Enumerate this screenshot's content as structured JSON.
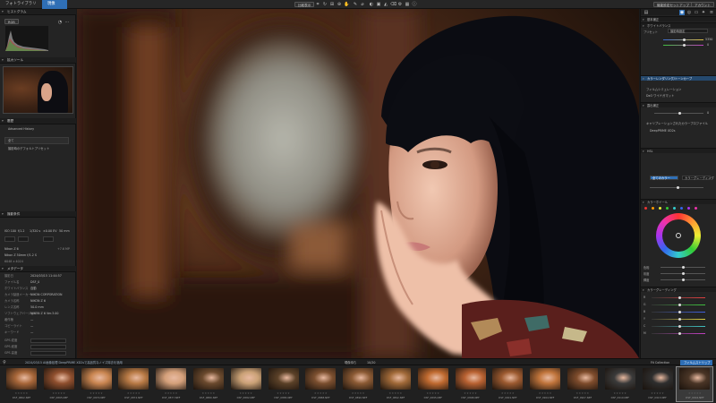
{
  "topbar": {
    "tabs": [
      {
        "label": "フォトライブラリ",
        "active": false
      },
      {
        "label": "現像",
        "active": true
      }
    ],
    "compare_label": "比較表示",
    "export_label": "書き出し",
    "workspace_label": "ワークスペース",
    "right_buttons": [
      "機能設定セットアップ",
      "アカウント"
    ]
  },
  "left": {
    "histogram_title": "ヒストグラム",
    "histogram_mode": "RGB",
    "navigator_title": "拡大ツール",
    "history_title": "履歴",
    "history_subtitle": "Advanced History",
    "history_items": [
      "全て",
      "撮影時のデフォルトプリセット"
    ],
    "exif_title": "撮影条件",
    "exif_top": [
      "ISO 100",
      "f/1.2",
      "1/320 s",
      "±0.00 EV",
      "50 mm"
    ],
    "lens_mount": "Nikon Z 6",
    "lens_name": "Nikon Z 50mm f/1.2 S",
    "image_size": "6048 x 4024",
    "camera_id": "+7.6 MP",
    "meta_title": "メタデータ",
    "meta_rows": [
      {
        "label": "撮影日",
        "value": "2024/03/15 11:44:57"
      },
      {
        "label": "ファイル名",
        "value": "DSF_0"
      },
      {
        "label": "ホワイトバランス",
        "value": "自動"
      },
      {
        "label": "カメラ製造メーカー",
        "value": "NIKON CORPORATION"
      },
      {
        "label": "カメラ名称",
        "value": "NIKON Z 6"
      },
      {
        "label": "レンズ名称",
        "value": "50.0 mm"
      },
      {
        "label": "ソフトウェアバージョン",
        "value": "NIKON Z 6 Ver.3.00"
      },
      {
        "label": "著作権",
        "value": "—"
      },
      {
        "label": "コピーライト",
        "value": "—"
      },
      {
        "label": "キーワード",
        "value": "—"
      }
    ],
    "gps_rows": [
      "GPS 緯度",
      "GPS 経度",
      "GPS 高度"
    ]
  },
  "right": {
    "header": "基本補正",
    "sections": [
      "ホワイトバランス",
      "カラーレンダリング/トーンカーブ",
      "露出補正",
      "HSL",
      "カラーホイール",
      "カラーグレーディング"
    ],
    "wb_preset": "撮影時設定",
    "temp_value": "5350",
    "tint_value": "0",
    "tone_type": "フィルムシミュレーション",
    "profile_name": "DxO ワイドガマット",
    "exposure_value": "0",
    "vignette_label": "キャリブレーションされたカラープロファイル",
    "deep_prime_label": "DeepPRIME XD2s",
    "hsl_mode": "全てのカラー",
    "grading_mode": "カラーグレーディング",
    "wheel_rows": [
      "色相",
      "彩度",
      "輝度"
    ],
    "channel_rows": [
      "R",
      "G",
      "B",
      "Y",
      "C",
      "M"
    ]
  },
  "statusbar": {
    "left_text": "2024/03/15 AI画像処理 DeepPRIME XD2sで高品質なノイズ除去を適用",
    "center_text": "現像待ち",
    "count": "10/20",
    "right_label": "フィルムストリップ",
    "fit_label": "Fit Collection"
  },
  "filmstrip": {
    "thumbs": [
      {
        "name": "DSF_0862.NEF",
        "color": "#a8673a",
        "selected": false
      },
      {
        "name": "DSF_0865.NEF",
        "color": "#8f4f2e",
        "selected": false
      },
      {
        "name": "DSF_0870.NEF",
        "color": "#c98550",
        "selected": false
      },
      {
        "name": "DSF_0872.NEF",
        "color": "#b87a45",
        "selected": false
      },
      {
        "name": "DSF_0877.NEF",
        "color": "#d4a07a",
        "selected": false
      },
      {
        "name": "DSF_0880.NEF",
        "color": "#6b4a2e",
        "selected": false
      },
      {
        "name": "DSF_0882.NEF",
        "color": "#caa176",
        "selected": false
      },
      {
        "name": "DSF_0885.NEF",
        "color": "#5b4128",
        "selected": false
      },
      {
        "name": "DSF_0888.NEF",
        "color": "#7b4f2f",
        "selected": false
      },
      {
        "name": "DSF_0890.NEF",
        "color": "#8b5a34",
        "selected": false
      },
      {
        "name": "DSF_0892.NEF",
        "color": "#a06938",
        "selected": false
      },
      {
        "name": "DSF_0895.NEF",
        "color": "#c06a30",
        "selected": false
      },
      {
        "name": "DSF_0898.NEF",
        "color": "#b96232",
        "selected": false
      },
      {
        "name": "DSF_0901.NEF",
        "color": "#9c5a30",
        "selected": false
      },
      {
        "name": "DSF_0904.NEF",
        "color": "#c0743b",
        "selected": false
      },
      {
        "name": "DSF_0907.NEF",
        "color": "#7e4c2c",
        "selected": false
      },
      {
        "name": "DSF_0910.NEF",
        "color": "#3a3a3a",
        "selected": false
      },
      {
        "name": "DSF_0913.NEF",
        "color": "#2e2e2e",
        "selected": false
      },
      {
        "name": "DSF_0916.NEF",
        "color": "#4a3526",
        "selected": true
      }
    ]
  },
  "colors": {
    "accent": "#2f6fb6",
    "panel": "#242424",
    "section_blue": "#25496e"
  }
}
